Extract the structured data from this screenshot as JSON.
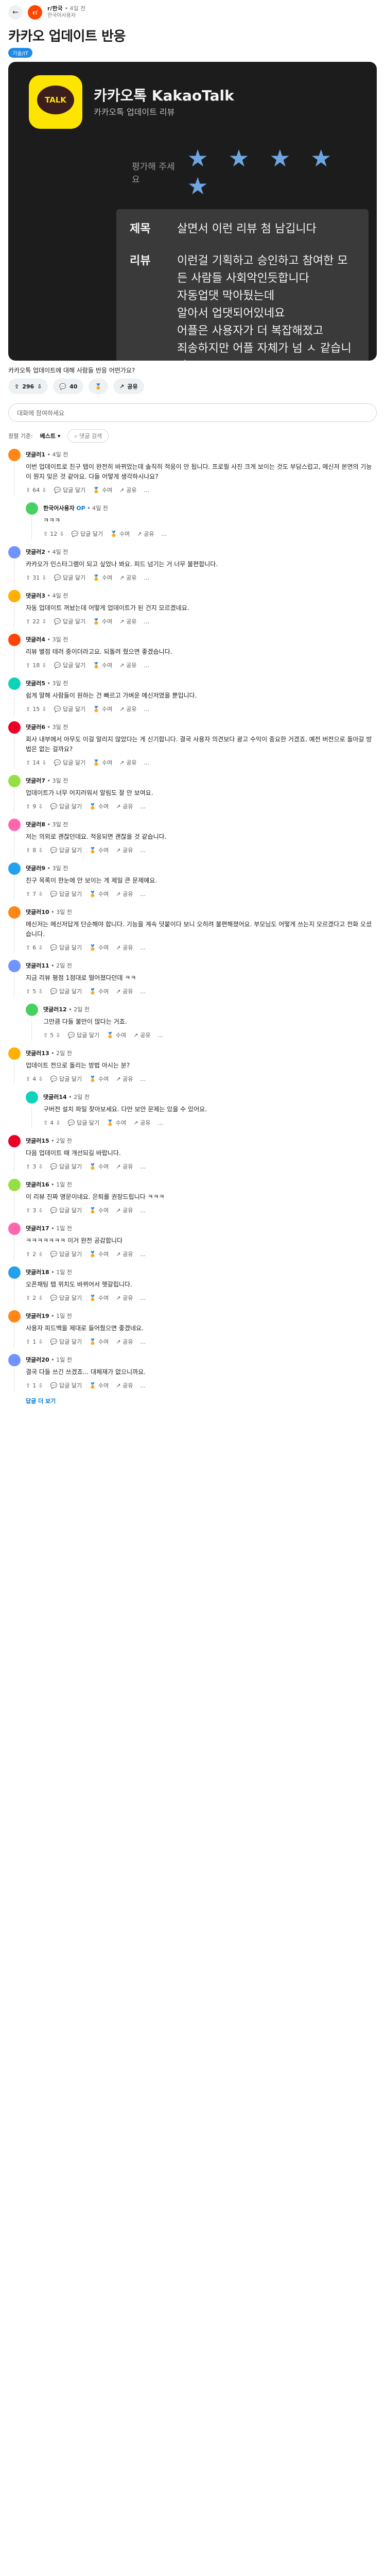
{
  "header": {
    "subreddit": "r/한국",
    "time": "• 4일 전",
    "author": "한국어사용자",
    "back_icon": "arrow-left-icon"
  },
  "post": {
    "title": "카카오 업데이트 반응",
    "flair": "기술/IT",
    "image": {
      "app_name": "카카오톡 KakaoTalk",
      "app_desc": "카카오톡 업데이트 리뷰",
      "logo_text": "TALK",
      "rating_label": "평가해 주세요",
      "stars": "★ ★ ★ ★ ★",
      "review_title_key": "제목",
      "review_title_val": "살면서 이런 리뷰 첨 남깁니다",
      "review_body_key": "리뷰",
      "review_body_val": "이런걸 기획하고 승인하고 참여한 모든 사람들 사회악인듯합니다\n자동업댓 막아뒀는데\n알아서 업댓되어있네요\n어플은 사용자가 더 복잡해졌고\n죄송하지만 어플 자체가 넘 ㅅ 같습니다\n이런 감각으로 현역으로 일하고\n계십니까? 모두를 위해 은퇴를\n권장드립니다"
    },
    "caption": "카카오톡 업데이트에 대해 사람들 반응 어떤가요?",
    "actions": {
      "upvote_count": "296",
      "comment_count": "40",
      "share_label": "공유"
    }
  },
  "comment_box": {
    "placeholder": "대화에 참여하세요"
  },
  "sort": {
    "label": "정렬 기준:",
    "value": "베스트",
    "search": "댓글 검색"
  },
  "action_labels": {
    "reply": "답글 달기",
    "award": "수여",
    "share": "공유",
    "more": "..."
  },
  "comments": [
    {
      "user": "댓글러1",
      "time": "4일 전",
      "votes": "64",
      "op": false,
      "reply": false,
      "color": "#ff8717",
      "text": "이번 업데이트로 친구 탭이 완전히 바뀌었는데 솔직히 적응이 안 됩니다. 프로필 사진 크게 보이는 것도 부담스럽고, 메신저 본연의 기능이 뭔지 잊은 것 같아요. 다들 어떻게 생각하시나요?"
    },
    {
      "user": "한국어사용자",
      "time": "4일 전",
      "votes": "12",
      "op": true,
      "reply": true,
      "color": "#46d160",
      "text": "ㅋㅋㅋ"
    },
    {
      "user": "댓글러2",
      "time": "4일 전",
      "votes": "31",
      "op": false,
      "reply": false,
      "color": "#7193ff",
      "text": "카카오가 인스타그램이 되고 싶었나 봐요. 피드 넘기는 거 너무 불편합니다."
    },
    {
      "user": "댓글러3",
      "time": "4일 전",
      "votes": "22",
      "op": false,
      "reply": false,
      "color": "#ffb000",
      "text": "자동 업데이트 꺼놨는데 어떻게 업데이트가 된 건지 모르겠네요."
    },
    {
      "user": "댓글러4",
      "time": "3일 전",
      "votes": "18",
      "op": false,
      "reply": false,
      "color": "#ff4500",
      "text": "리뷰 별점 테러 중이더라고요. 되돌려 줬으면 좋겠습니다."
    },
    {
      "user": "댓글러5",
      "time": "3일 전",
      "votes": "15",
      "op": false,
      "reply": false,
      "color": "#0dd3bb",
      "text": "쉽게 말해 사람들이 원하는 건 빠르고 가벼운 메신저였을 뿐입니다."
    },
    {
      "user": "댓글러6",
      "time": "3일 전",
      "votes": "14",
      "op": false,
      "reply": false,
      "color": "#ea0027",
      "text": "회사 내부에서 아무도 이걸 말리지 않았다는 게 신기합니다. 결국 사용자 의견보다 광고 수익이 중요한 거겠죠. 예전 버전으로 돌아갈 방법은 없는 걸까요?"
    },
    {
      "user": "댓글러7",
      "time": "3일 전",
      "votes": "9",
      "op": false,
      "reply": false,
      "color": "#94e044",
      "text": "업데이트가 너무 어지러워서 알림도 잘 안 보여요."
    },
    {
      "user": "댓글러8",
      "time": "3일 전",
      "votes": "8",
      "op": false,
      "reply": false,
      "color": "#ff66ac",
      "text": "저는 의외로 괜찮던데요. 적응되면 괜찮을 것 같습니다."
    },
    {
      "user": "댓글러9",
      "time": "3일 전",
      "votes": "7",
      "op": false,
      "reply": false,
      "color": "#24a0ed",
      "text": "친구 목록이 한눈에 안 보이는 게 제일 큰 문제예요."
    },
    {
      "user": "댓글러10",
      "time": "3일 전",
      "votes": "6",
      "op": false,
      "reply": false,
      "color": "#ff8717",
      "text": "메신저는 메신저답게 단순해야 합니다. 기능을 계속 덧붙이다 보니 오히려 불편해졌어요. 부모님도 어떻게 쓰는지 모르겠다고 전화 오셨습니다."
    },
    {
      "user": "댓글러11",
      "time": "2일 전",
      "votes": "5",
      "op": false,
      "reply": false,
      "color": "#7193ff",
      "text": "지금 리뷰 평점 1점대로 떨어졌다던데 ㅋㅋ"
    },
    {
      "user": "댓글러12",
      "time": "2일 전",
      "votes": "5",
      "op": false,
      "reply": true,
      "color": "#46d160",
      "text": "그만큼 다들 불만이 많다는 거죠."
    },
    {
      "user": "댓글러13",
      "time": "2일 전",
      "votes": "4",
      "op": false,
      "reply": false,
      "color": "#ffb000",
      "text": "업데이트 전으로 돌리는 방법 아시는 분?"
    },
    {
      "user": "댓글러14",
      "time": "2일 전",
      "votes": "4",
      "op": false,
      "reply": true,
      "color": "#0dd3bb",
      "text": "구버전 설치 파일 찾아보세요. 다만 보안 문제는 있을 수 있어요."
    },
    {
      "user": "댓글러15",
      "time": "2일 전",
      "votes": "3",
      "op": false,
      "reply": false,
      "color": "#ea0027",
      "text": "다음 업데이트 때 개선되길 바랍니다."
    },
    {
      "user": "댓글러16",
      "time": "1일 전",
      "votes": "3",
      "op": false,
      "reply": false,
      "color": "#94e044",
      "text": "이 리뷰 진짜 명문이네요. 은퇴를 권장드립니다 ㅋㅋㅋ"
    },
    {
      "user": "댓글러17",
      "time": "1일 전",
      "votes": "2",
      "op": false,
      "reply": false,
      "color": "#ff66ac",
      "text": "ㅋㅋㅋㅋㅋㅋㅋ 이거 완전 공감합니다"
    },
    {
      "user": "댓글러18",
      "time": "1일 전",
      "votes": "2",
      "op": false,
      "reply": false,
      "color": "#24a0ed",
      "text": "오픈채팅 탭 위치도 바뀌어서 헷갈립니다."
    },
    {
      "user": "댓글러19",
      "time": "1일 전",
      "votes": "1",
      "op": false,
      "reply": false,
      "color": "#ff8717",
      "text": "사용자 피드백을 제대로 들어줬으면 좋겠네요."
    },
    {
      "user": "댓글러20",
      "time": "1일 전",
      "votes": "1",
      "op": false,
      "reply": false,
      "color": "#7193ff",
      "text": "결국 다들 쓰긴 쓰겠죠... 대체재가 없으니까요."
    }
  ],
  "more_replies_label": "답글 더 보기"
}
